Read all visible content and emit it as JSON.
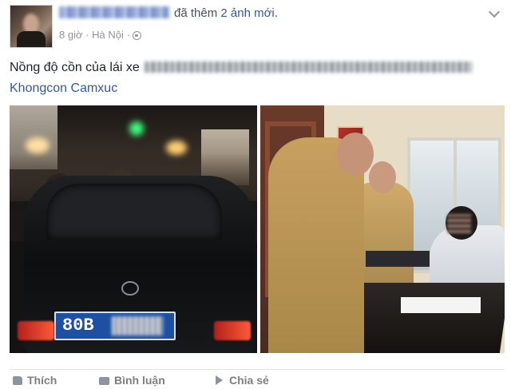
{
  "post": {
    "author_action": "đã thêm",
    "photo_count": "2 ảnh mới",
    "period": ".",
    "time": "8 giờ",
    "separator": "·",
    "location": "Hà Nội",
    "separator2": "·",
    "text": "Nồng độ cồn của lái xe",
    "tagged": "Khongcon Camxuc"
  },
  "photos": {
    "left": {
      "plate_visible": "80B"
    }
  },
  "actions": {
    "like": "Thích",
    "comment": "Bình luận",
    "share": "Chia sẻ"
  }
}
